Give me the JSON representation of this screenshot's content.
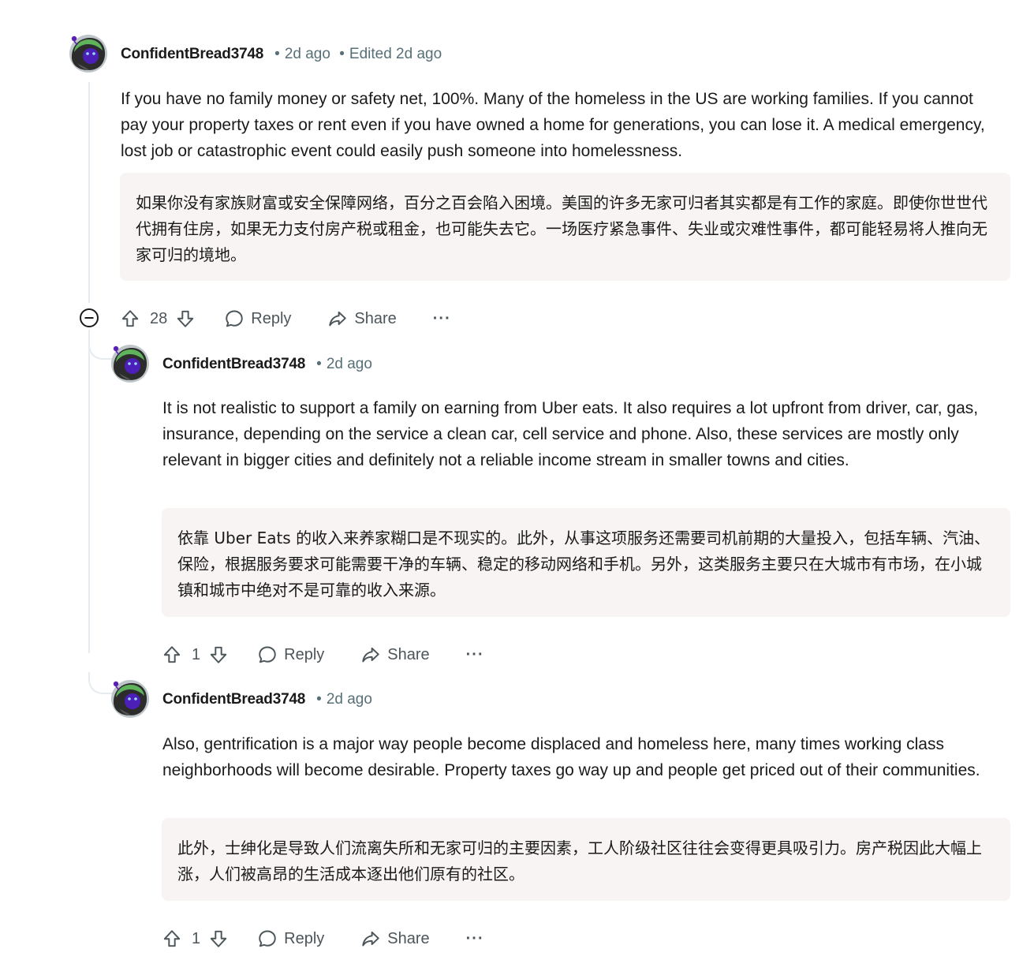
{
  "colors": {
    "thread_line": "#e5ebee",
    "translation_bg": "#f8f4f3",
    "meta_text": "#576f76",
    "action_text": "#4c5559",
    "avatar_green": "#5fb35a",
    "avatar_purple": "#4b1fb8"
  },
  "comments": [
    {
      "author": "ConfidentBread3748",
      "time": "2d ago",
      "edited": "Edited 2d ago",
      "body": "If you have no family money or safety net, 100%. Many of the homeless in the US are working families. If you cannot pay your property taxes or rent even if you have owned a home for generations, you can lose it. A medical emergency, lost job or catastrophic event could easily push someone into homelessness.",
      "translation": "如果你没有家族财富或安全保障网络，百分之百会陷入困境。美国的许多无家可归者其实都是有工作的家庭。即使你世世代代拥有住房，如果无力支付房产税或租金，也可能失去它。一场医疗紧急事件、失业或灾难性事件，都可能轻易将人推向无家可归的境地。",
      "votes": "28",
      "reply_label": "Reply",
      "share_label": "Share",
      "more_label": "···"
    },
    {
      "author": "ConfidentBread3748",
      "time": "2d ago",
      "body": "It is not realistic to support a family on earning from Uber eats. It also requires a lot upfront from driver, car, gas, insurance, depending on the service a clean car, cell service and phone. Also, these services are mostly only relevant in bigger cities and definitely not a reliable income stream in smaller towns and cities.",
      "translation": "依靠 Uber Eats 的收入来养家糊口是不现实的。此外，从事这项服务还需要司机前期的大量投入，包括车辆、汽油、保险，根据服务要求可能需要干净的车辆、稳定的移动网络和手机。另外，这类服务主要只在大城市有市场，在小城镇和城市中绝对不是可靠的收入来源。",
      "votes": "1",
      "reply_label": "Reply",
      "share_label": "Share",
      "more_label": "···"
    },
    {
      "author": "ConfidentBread3748",
      "time": "2d ago",
      "body": "Also, gentrification is a major way people become displaced and homeless here, many times working class neighborhoods will become desirable. Property taxes go way up and people get priced out of their communities.",
      "translation": "此外，士绅化是导致人们流离失所和无家可归的主要因素，工人阶级社区往往会变得更具吸引力。房产税因此大幅上涨，人们被高昂的生活成本逐出他们原有的社区。",
      "votes": "1",
      "reply_label": "Reply",
      "share_label": "Share",
      "more_label": "···"
    }
  ]
}
